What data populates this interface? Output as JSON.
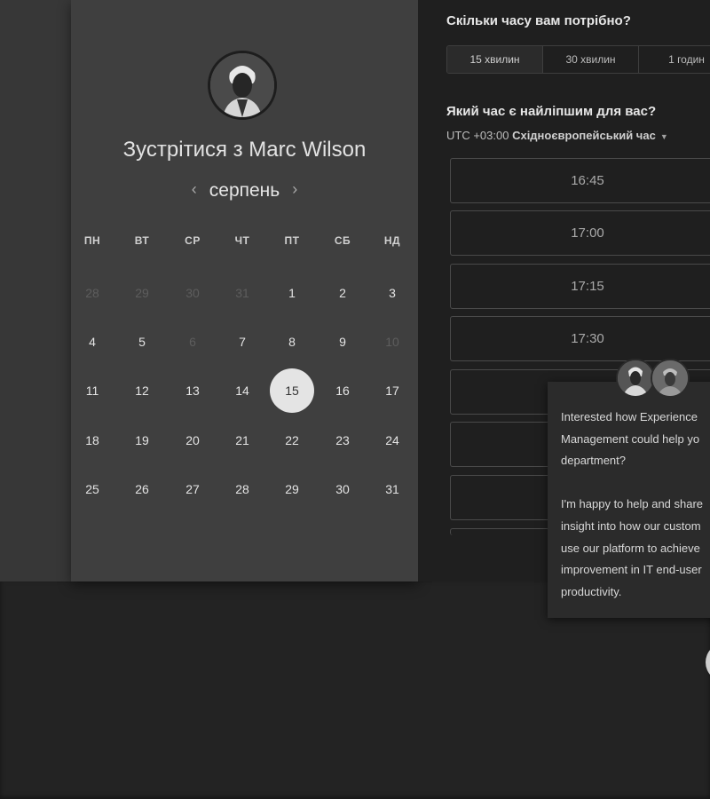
{
  "calendar": {
    "title": "Зустрітися з Marc Wilson",
    "month": "серпень",
    "prev_icon": "‹",
    "next_icon": "›",
    "weekdays": [
      "ПН",
      "ВТ",
      "СР",
      "ЧТ",
      "ПТ",
      "СБ",
      "НД"
    ],
    "weeks": [
      [
        {
          "d": "28",
          "m": true
        },
        {
          "d": "29",
          "m": true
        },
        {
          "d": "30",
          "m": true
        },
        {
          "d": "31",
          "m": true
        },
        {
          "d": "1"
        },
        {
          "d": "2"
        },
        {
          "d": "3"
        }
      ],
      [
        {
          "d": "4"
        },
        {
          "d": "5"
        },
        {
          "d": "6",
          "m": true
        },
        {
          "d": "7"
        },
        {
          "d": "8"
        },
        {
          "d": "9"
        },
        {
          "d": "10",
          "m": true
        }
      ],
      [
        {
          "d": "11"
        },
        {
          "d": "12"
        },
        {
          "d": "13"
        },
        {
          "d": "14"
        },
        {
          "d": "15",
          "s": true
        },
        {
          "d": "16"
        },
        {
          "d": "17"
        }
      ],
      [
        {
          "d": "18"
        },
        {
          "d": "19"
        },
        {
          "d": "20"
        },
        {
          "d": "21"
        },
        {
          "d": "22"
        },
        {
          "d": "23"
        },
        {
          "d": "24"
        }
      ],
      [
        {
          "d": "25"
        },
        {
          "d": "26"
        },
        {
          "d": "27"
        },
        {
          "d": "28"
        },
        {
          "d": "29"
        },
        {
          "d": "30"
        },
        {
          "d": "31"
        }
      ]
    ]
  },
  "booking": {
    "duration_question": "Скільки часу вам потрібно?",
    "durations": [
      "15 хвилин",
      "30 хвилин",
      "1 годин"
    ],
    "time_question": "Який час є найліпшим для вас?",
    "timezone_prefix": "UTC +03:00",
    "timezone_name": "Східноєвропейський час",
    "slots": [
      "16:45",
      "17:00",
      "17:15",
      "17:30",
      "",
      "",
      ""
    ]
  },
  "chat": {
    "message": "Interested how Experience\nManagement could help yo\ndepartment?\n\nI'm happy to help and share\ninsight into how our custom\nuse our platform to achieve\nimprovement in IT end-user\nproductivity."
  },
  "icons": {
    "caret": "▼"
  },
  "colors": {
    "card_bg": "#3f3f3f",
    "panel_bg": "#1f1f1f",
    "selected_day": "#e4e4e4"
  }
}
